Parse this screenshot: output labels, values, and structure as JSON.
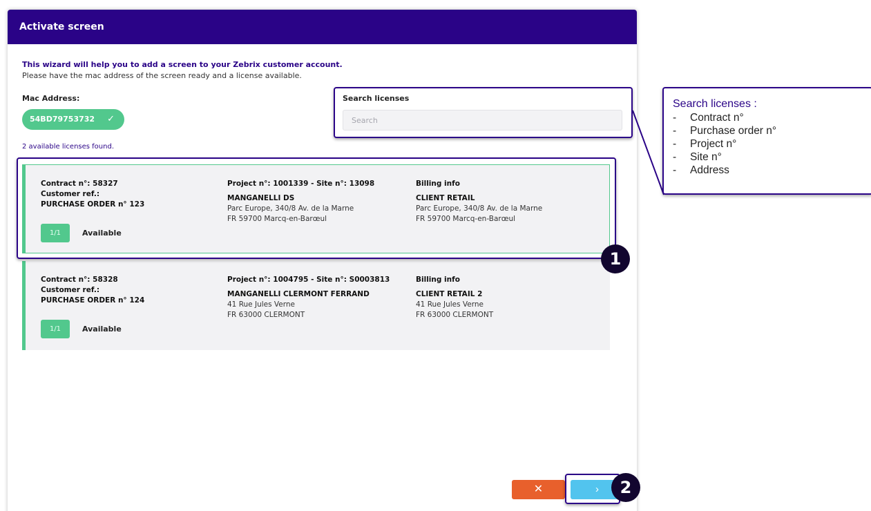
{
  "modal": {
    "title": "Activate screen",
    "intro_heading": "This wizard will help you to add a screen to your Zebrix customer account.",
    "intro_text": "Please have the mac address of the screen ready and a license available."
  },
  "mac": {
    "label": "Mac Address:",
    "value": "54BD79753732",
    "check_icon": "✓"
  },
  "search": {
    "label": "Search licenses",
    "placeholder": "Search",
    "value": ""
  },
  "results_text": "2 available licenses found.",
  "licenses": [
    {
      "contract": "Contract n°: 58327",
      "customer_ref": "Customer ref.:",
      "purchase_order": "PURCHASE ORDER n° 123",
      "project_site": "Project n°: 1001339 - Site n°: 13098",
      "site_name": "MANGANELLI DS",
      "site_address_1": "Parc Europe, 340/8 Av. de la Marne",
      "site_address_2": "FR 59700 Marcq-en-Barœul",
      "billing_label": "Billing info",
      "billing_name": "CLIENT RETAIL",
      "billing_address_1": "Parc Europe, 340/8 Av. de la Marne",
      "billing_address_2": "FR 59700 Marcq-en-Barœul",
      "count": "1/1",
      "status": "Available"
    },
    {
      "contract": "Contract n°: 58328",
      "customer_ref": "Customer ref.:",
      "purchase_order": "PURCHASE ORDER n° 124",
      "project_site": "Project n°: 1004795 - Site n°: S0003813",
      "site_name": "MANGANELLI CLERMONT FERRAND",
      "site_address_1": "41 Rue Jules Verne",
      "site_address_2": "FR 63000 CLERMONT",
      "billing_label": "Billing info",
      "billing_name": "CLIENT RETAIL 2",
      "billing_address_1": "41 Rue Jules Verne",
      "billing_address_2": "FR 63000 CLERMONT",
      "count": "1/1",
      "status": "Available"
    }
  ],
  "buttons": {
    "cancel_icon": "✕",
    "next_icon": "›"
  },
  "annotations": {
    "marker_1": "1",
    "marker_2": "2",
    "callout_title": "Search licenses :",
    "callout_dash": "-",
    "callout_items": [
      "Contract n°",
      "Purchase order n°",
      "Project n°",
      "Site n°",
      "Address"
    ]
  },
  "colors": {
    "header": "#2a0387",
    "accent_green": "#52c88d",
    "cancel": "#e8602c",
    "next": "#52c4ee",
    "card_bg": "#f2f2f4"
  }
}
